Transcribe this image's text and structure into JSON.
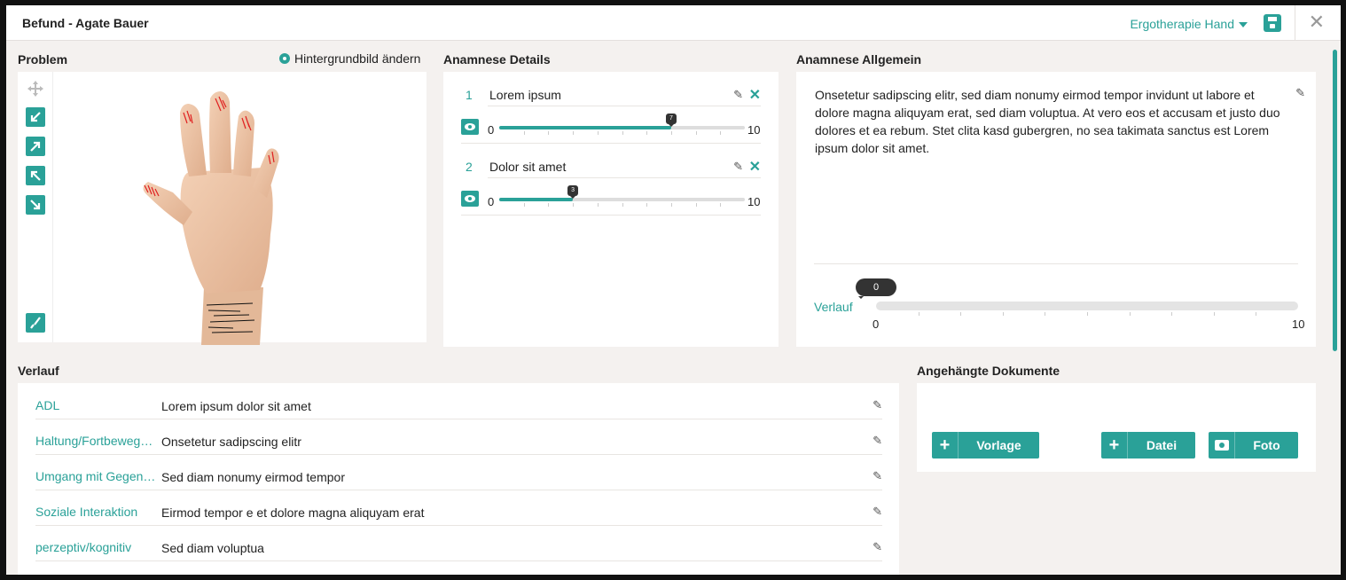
{
  "window": {
    "title": "Befund - Agate Bauer",
    "therapy_select": "Ergotherapie Hand",
    "close_label": "✕"
  },
  "problem": {
    "label": "Problem",
    "change_background": "Hintergrundbild ändern"
  },
  "details": {
    "label": "Anamnese Details",
    "items": [
      {
        "num": "1",
        "label": "Lorem ipsum",
        "value": 7,
        "value_label": "7",
        "min": "0",
        "max": "10"
      },
      {
        "num": "2",
        "label": "Dolor sit amet",
        "value": 3,
        "value_label": "3",
        "min": "0",
        "max": "10"
      }
    ]
  },
  "general": {
    "label": "Anamnese Allgemein",
    "text": "Onsetetur sadipscing elitr, sed diam nonumy eirmod tempor invidunt ut labore et dolore magna aliquyam erat, sed diam voluptua. At vero eos et accusam et justo duo dolores et ea rebum. Stet clita kasd gubergren, no sea takimata sanctus est Lorem ipsum dolor sit amet.",
    "verlauf_label": "Verlauf",
    "verlauf_value": 0,
    "verlauf_value_label": "0",
    "min": "0",
    "max": "10"
  },
  "verlauf": {
    "label": "Verlauf",
    "rows": [
      {
        "key": "ADL",
        "value": "Lorem ipsum dolor sit amet"
      },
      {
        "key": "Haltung/Fortbewegung",
        "value": "Onsetetur sadipscing elitr"
      },
      {
        "key": "Umgang mit Gegenständen",
        "value": "Sed diam nonumy eirmod tempor"
      },
      {
        "key": "Soziale Interaktion",
        "value": "Eirmod tempor e et dolore magna aliquyam erat"
      },
      {
        "key": "perzeptiv/kognitiv",
        "value": "Sed diam voluptua"
      }
    ]
  },
  "documents": {
    "label": "Angehängte Dokumente",
    "template_button": "Vorlage",
    "file_button": "Datei",
    "photo_button": "Foto"
  },
  "colors": {
    "accent": "#2aa198",
    "background": "#f4f1ef"
  }
}
